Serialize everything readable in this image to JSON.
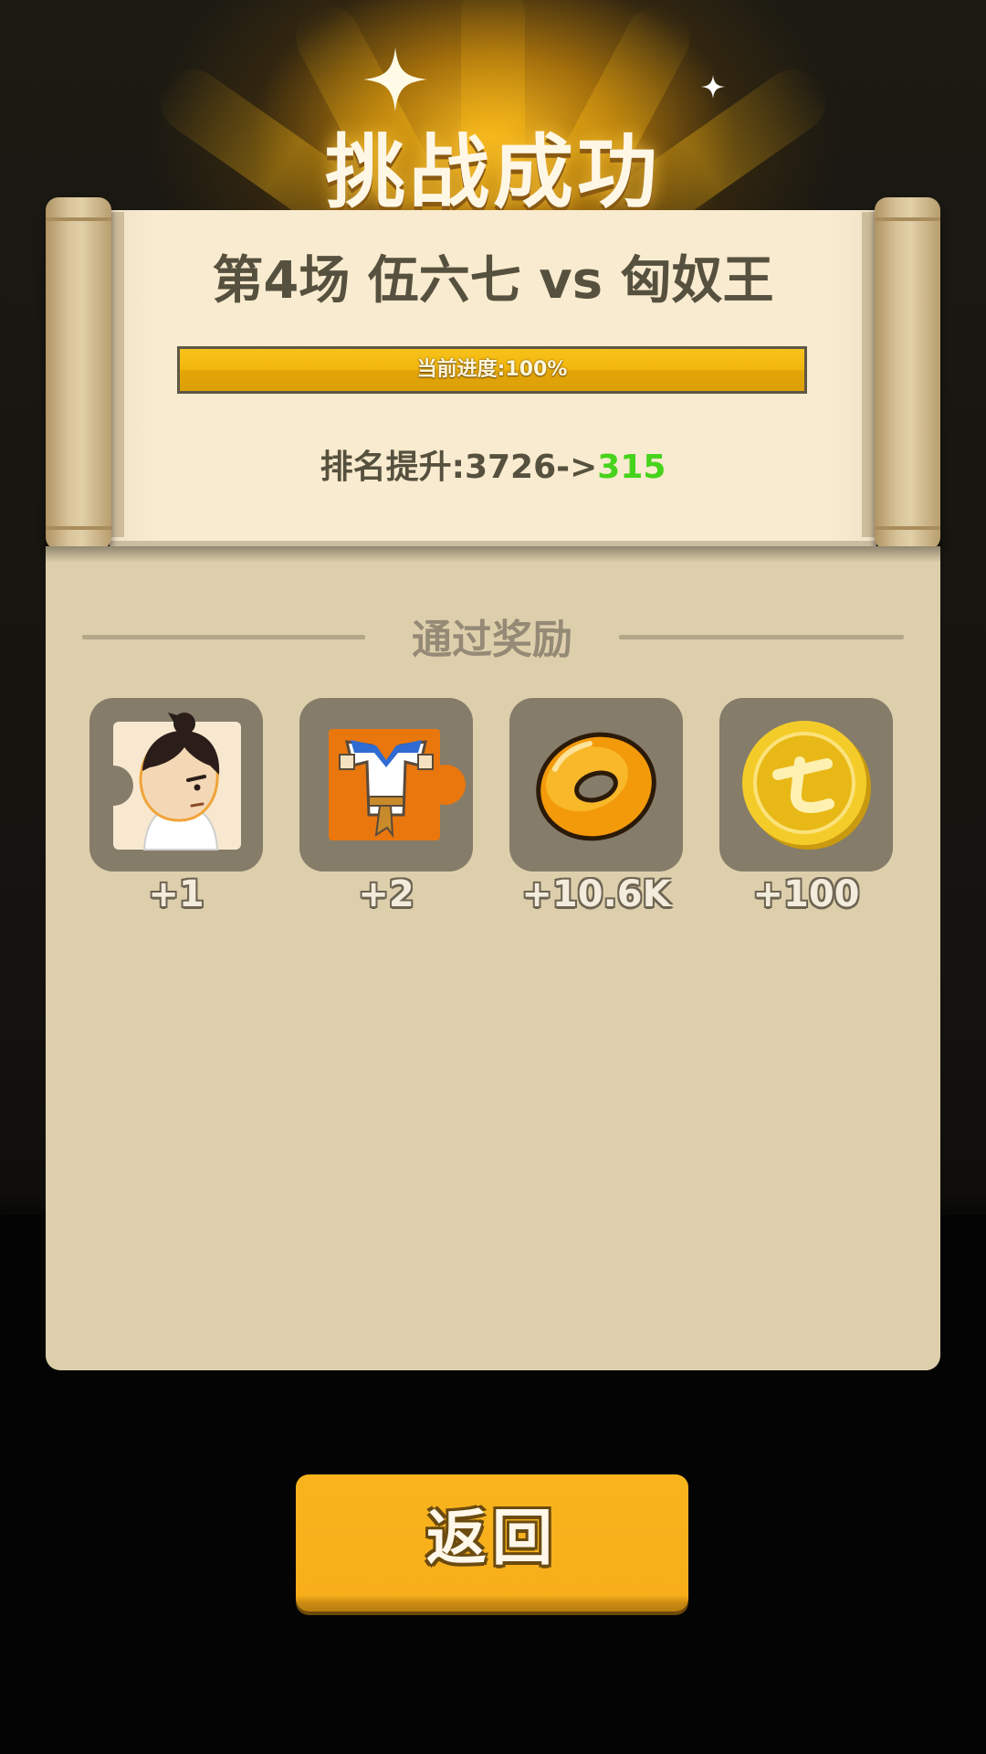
{
  "header": {
    "title": "挑战成功"
  },
  "match": {
    "title": "第4场 伍六七 vs 匈奴王",
    "progress_text": "当前进度:100%",
    "progress_value": 1.0,
    "rank_label": "排名提升:3726->",
    "rank_new": "315"
  },
  "rewards": {
    "section_title": "通过奖励",
    "items": [
      {
        "icon": "character-fragment-icon",
        "count": "+1"
      },
      {
        "icon": "outfit-fragment-icon",
        "count": "+2"
      },
      {
        "icon": "orange-ring-icon",
        "count": "+10.6K"
      },
      {
        "icon": "gold-coin-icon",
        "count": "+100"
      }
    ]
  },
  "actions": {
    "back_label": "返回"
  },
  "colors": {
    "accent_yellow": "#f7ae1a",
    "rank_green": "#46d31c",
    "panel_bg": "#decfac",
    "paper_bg": "#f9ebcf",
    "text_dark": "#56513f"
  }
}
